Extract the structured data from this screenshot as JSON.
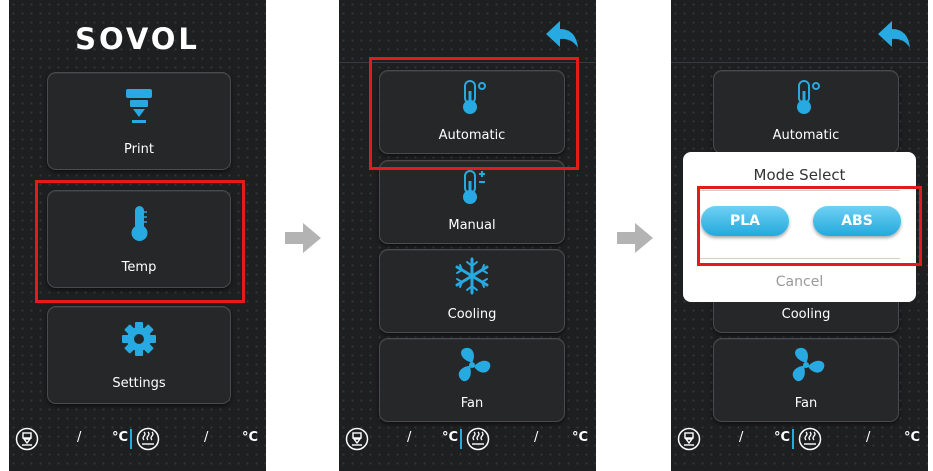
{
  "screen1": {
    "logo": "SOVOL",
    "buttons": [
      {
        "label": "Print",
        "icon": "print-icon"
      },
      {
        "label": "Temp",
        "icon": "thermometer-icon"
      },
      {
        "label": "Settings",
        "icon": "gear-icon"
      }
    ]
  },
  "screen2": {
    "buttons": [
      {
        "label": "Automatic",
        "icon": "thermometer-auto-icon"
      },
      {
        "label": "Manual",
        "icon": "thermometer-manual-icon"
      },
      {
        "label": "Cooling",
        "icon": "snowflake-icon"
      },
      {
        "label": "Fan",
        "icon": "fan-icon"
      }
    ]
  },
  "screen3": {
    "buttons": [
      {
        "label": "Automatic",
        "icon": "thermometer-auto-icon"
      },
      {
        "label": "Cooling",
        "icon": "snowflake-icon"
      },
      {
        "label": "Fan",
        "icon": "fan-icon"
      }
    ],
    "modal": {
      "title": "Mode Select",
      "option_pla": "PLA",
      "option_abs": "ABS",
      "cancel": "Cancel"
    }
  },
  "status": {
    "slash": "/",
    "unit": "°C"
  },
  "colors": {
    "accent": "#27a9e1",
    "highlight": "#e31b1b",
    "background": "#1e1f21"
  }
}
